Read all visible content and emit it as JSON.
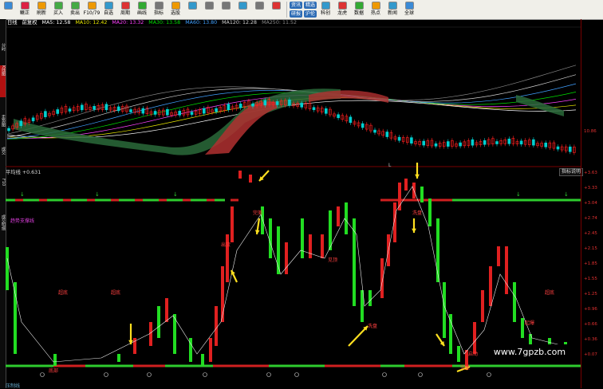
{
  "toolbar": {
    "buttons": [
      {
        "label": "",
        "icon": "grid-icon"
      },
      {
        "label": "",
        "icon": "pin-icon"
      },
      {
        "label": "",
        "icon": "house-icon"
      },
      {
        "label": "",
        "icon": "back-icon"
      },
      {
        "label": "",
        "icon": "forward-icon"
      },
      {
        "label": "",
        "icon": "face-icon"
      },
      {
        "label": "",
        "icon": "refresh-icon"
      },
      {
        "label": "",
        "icon": "buy-icon"
      },
      {
        "label": "",
        "icon": "sell-icon"
      },
      {
        "label": "",
        "icon": "f1079-icon"
      },
      {
        "label": "",
        "icon": "star-icon"
      },
      {
        "label": "",
        "icon": "cycle-icon"
      },
      {
        "label": "",
        "icon": "line-icon"
      },
      {
        "label": "",
        "icon": "pen-icon"
      },
      {
        "label": "",
        "icon": "eye-icon"
      },
      {
        "label": "",
        "icon": "stock-icon"
      },
      {
        "label": "",
        "icon": "flag-icon"
      }
    ],
    "labels_a": [
      "",
      "鳜正",
      "刷新",
      "买入",
      "卖出",
      "F10/79",
      "自选",
      "周期",
      "画线",
      "指标",
      "选股",
      "",
      "",
      "",
      "",
      "",
      ""
    ],
    "pills": [
      "资讯",
      "研报",
      "精选",
      "沪伦"
    ],
    "labels_b": [
      "科创",
      "龙虎",
      "数据",
      "热点",
      "新闻",
      "全球"
    ]
  },
  "sidebar": {
    "tabs": [
      "",
      "分时",
      "K线图",
      "走势图",
      "成交",
      "F10",
      "成交明细"
    ]
  },
  "legend": {
    "period": "日线",
    "name": "前复权",
    "ma5": "MA5: 12.58",
    "ma10": "MA10: 12.42",
    "ma20": "MA20: 13.32",
    "ma30": "MA30: 13.58",
    "ma60": "MA60: 13.80",
    "ma120": "MA120: 12.28",
    "ma250": "MA250: 11.52"
  },
  "indicator": {
    "title": "平均线 +0.631",
    "help": "指标说明",
    "trend_label": "趋势支撑线",
    "bottom_label": "压制线",
    "annotations": [
      "超底",
      "超底",
      "超底",
      "出货",
      "完美",
      "洗盘",
      "底部",
      "见顶",
      "起爆",
      "启动",
      "洗盘",
      "完美",
      "L"
    ]
  },
  "price_axis": {
    "ticks": [
      "10.86"
    ]
  },
  "indicator_axis": {
    "ticks": [
      "+3.63",
      "+3.33",
      "+3.04",
      "+2.74",
      "+2.45",
      "+2.15",
      "+1.85",
      "+1.55",
      "+1.25",
      "+0.96",
      "+0.66",
      "+0.36",
      "+0.07"
    ]
  },
  "watermark": "www.7gpzb.com",
  "colors": {
    "up": "#ff2020",
    "down": "#22dd22",
    "axis": "#770000",
    "ma5": "#ffffff",
    "ma10": "#e8e800",
    "ma20": "#ff40ff",
    "ma30": "#00e000",
    "ma60": "#40a0ff",
    "ma120": "#d0d0d0",
    "ma250": "#888888"
  }
}
